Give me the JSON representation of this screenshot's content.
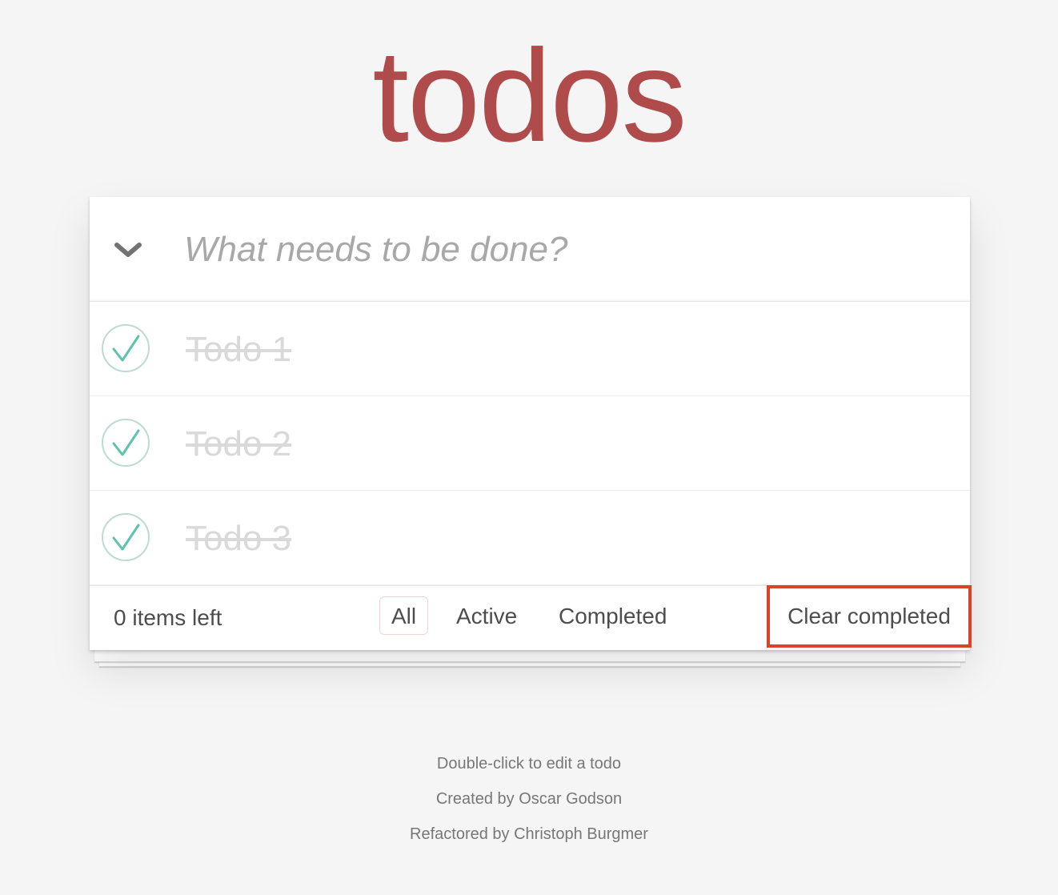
{
  "app": {
    "title": "todos"
  },
  "header": {
    "toggle_all_icon": "chevron-down-icon",
    "new_todo_placeholder": "What needs to be done?",
    "new_todo_value": ""
  },
  "todos": [
    {
      "title": "Todo 1",
      "completed": true
    },
    {
      "title": "Todo 2",
      "completed": true
    },
    {
      "title": "Todo 3",
      "completed": true
    }
  ],
  "footer": {
    "count_text": "0 items left",
    "filters": [
      {
        "label": "All",
        "selected": true
      },
      {
        "label": "Active",
        "selected": false
      },
      {
        "label": "Completed",
        "selected": false
      }
    ],
    "clear_completed_label": "Clear completed",
    "highlight_color": "#d9432a"
  },
  "info": {
    "hint": "Double-click to edit a todo",
    "created_by_prefix": "Created by ",
    "created_by_name": "Oscar Godson",
    "refactored_by_prefix": "Refactored by ",
    "refactored_by_name": "Christoph Burgmer"
  },
  "colors": {
    "title": "#af4b4b",
    "check": "#5dc2af",
    "check_circle": "#bddad5",
    "completed_text": "#d9d9d9",
    "background": "#f5f5f5"
  }
}
